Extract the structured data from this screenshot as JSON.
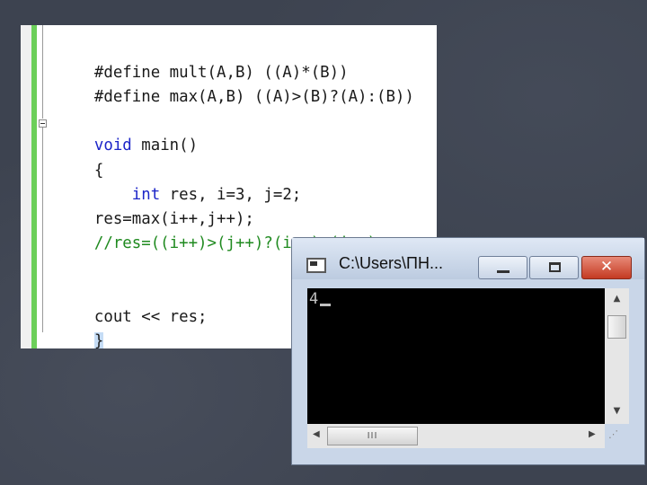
{
  "editor": {
    "lines": {
      "l1": "#define mult(A,B) ((A)*(B))",
      "l2": "#define max(A,B) ((A)>(B)?(A):(B))",
      "l3_kw": "void",
      "l3_rest": " main()",
      "l4": "{",
      "l5_indent": "    ",
      "l5_kw": "int",
      "l5_rest": " res, i=3, j=2;",
      "l6": "res=max(i++,j++);",
      "l7": "//res=((i++)>(j++)?(i++):(j++)",
      "l8": "cout << res;",
      "l9": "}"
    }
  },
  "console": {
    "title": "C:\\Users\\ПН...",
    "output": "4",
    "hscroll_grip": "III",
    "icons": {
      "app": "console-app-icon",
      "minimize": "minimize-icon",
      "maximize": "maximize-icon",
      "close": "close-icon"
    },
    "close_glyph": "✕",
    "accent_close": "#c43a22"
  }
}
